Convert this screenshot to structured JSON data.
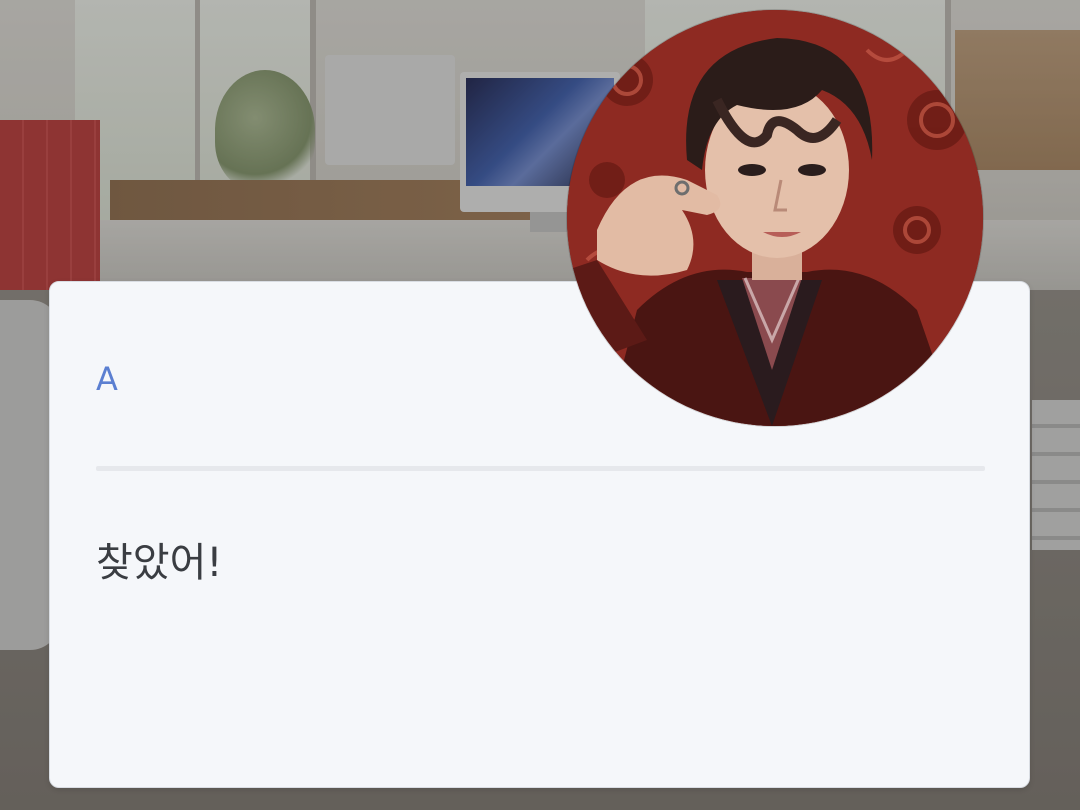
{
  "dialogue": {
    "speaker_name": "A",
    "message": "찾았어!"
  },
  "avatar": {
    "icon": "character-portrait-icon"
  },
  "colors": {
    "card_background": "#f5f7fa",
    "speaker_name": "#5b7fd1",
    "message_text": "#3a3d42",
    "divider": "#e6e8ec"
  }
}
